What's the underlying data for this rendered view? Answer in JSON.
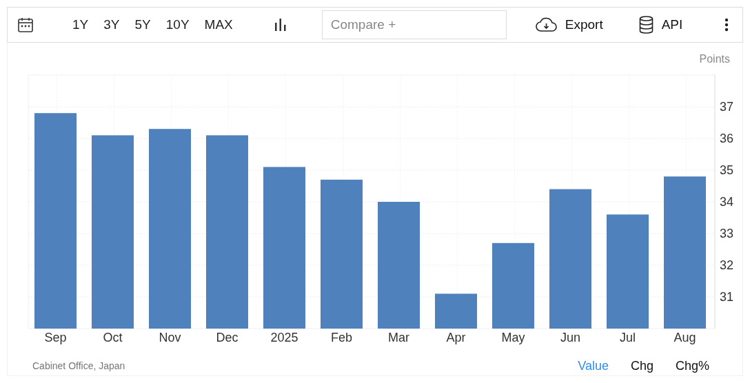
{
  "toolbar": {
    "ranges": [
      {
        "label": "1Y",
        "selected": false
      },
      {
        "label": "3Y",
        "selected": false
      },
      {
        "label": "5Y",
        "selected": false
      },
      {
        "label": "10Y",
        "selected": false
      },
      {
        "label": "MAX",
        "selected": false
      }
    ],
    "compare": {
      "placeholder": "Compare +"
    },
    "export": "Export",
    "api": "API"
  },
  "chart": {
    "unit": "Points",
    "chart_data": {
      "type": "bar",
      "categories": [
        "Sep",
        "Oct",
        "Nov",
        "Dec",
        "2025",
        "Feb",
        "Mar",
        "Apr",
        "May",
        "Jun",
        "Jul",
        "Aug"
      ],
      "grid": true,
      "series": [
        {
          "color": "#4f81bd",
          "values": [
            36.8,
            36.1,
            36.3,
            36.1,
            35.1,
            34.7,
            34.0,
            31.1,
            32.7,
            34.4,
            33.6,
            34.8
          ]
        }
      ],
      "ylim": [
        30,
        38
      ],
      "yticks": [
        31,
        32,
        33,
        34,
        35,
        36,
        37
      ]
    }
  },
  "source": "Cabinet Office, Japan",
  "views": [
    {
      "label": "Value",
      "selected": true
    },
    {
      "label": "Chg",
      "selected": false
    },
    {
      "label": "Chg%",
      "selected": false
    }
  ]
}
